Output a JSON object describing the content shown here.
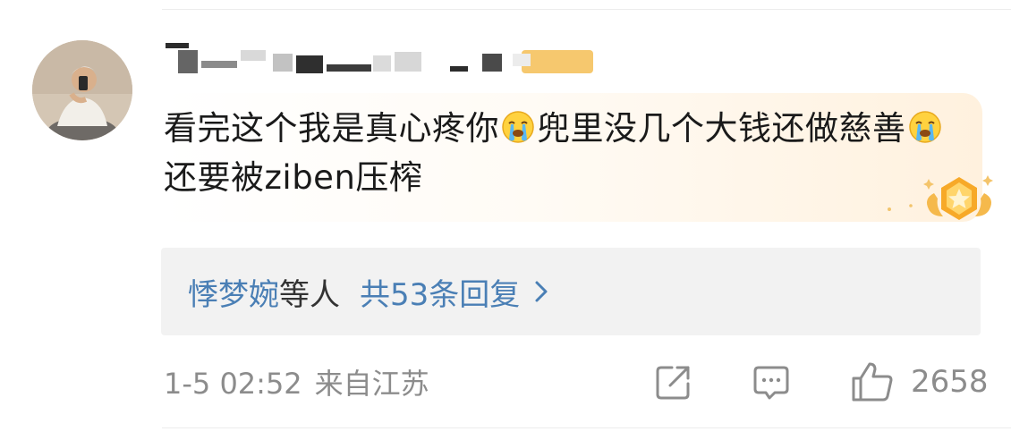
{
  "comment": {
    "username": "",
    "text_part1": "看完这个我是真心疼你",
    "text_part2": "兜里没几个大钱还做慈善",
    "text_part3": "还要被ziben压榨",
    "emoji": "crying-face-emoji"
  },
  "replies": {
    "user": "悸梦婉",
    "others": "等人",
    "count_label": "共53条回复"
  },
  "meta": {
    "time": "1-5 02:52",
    "location": "来自江苏"
  },
  "actions": {
    "like_count": "2658"
  },
  "colors": {
    "link": "#4a7fb5",
    "muted": "#8c8c8c",
    "reply_bg": "#f2f2f2"
  }
}
